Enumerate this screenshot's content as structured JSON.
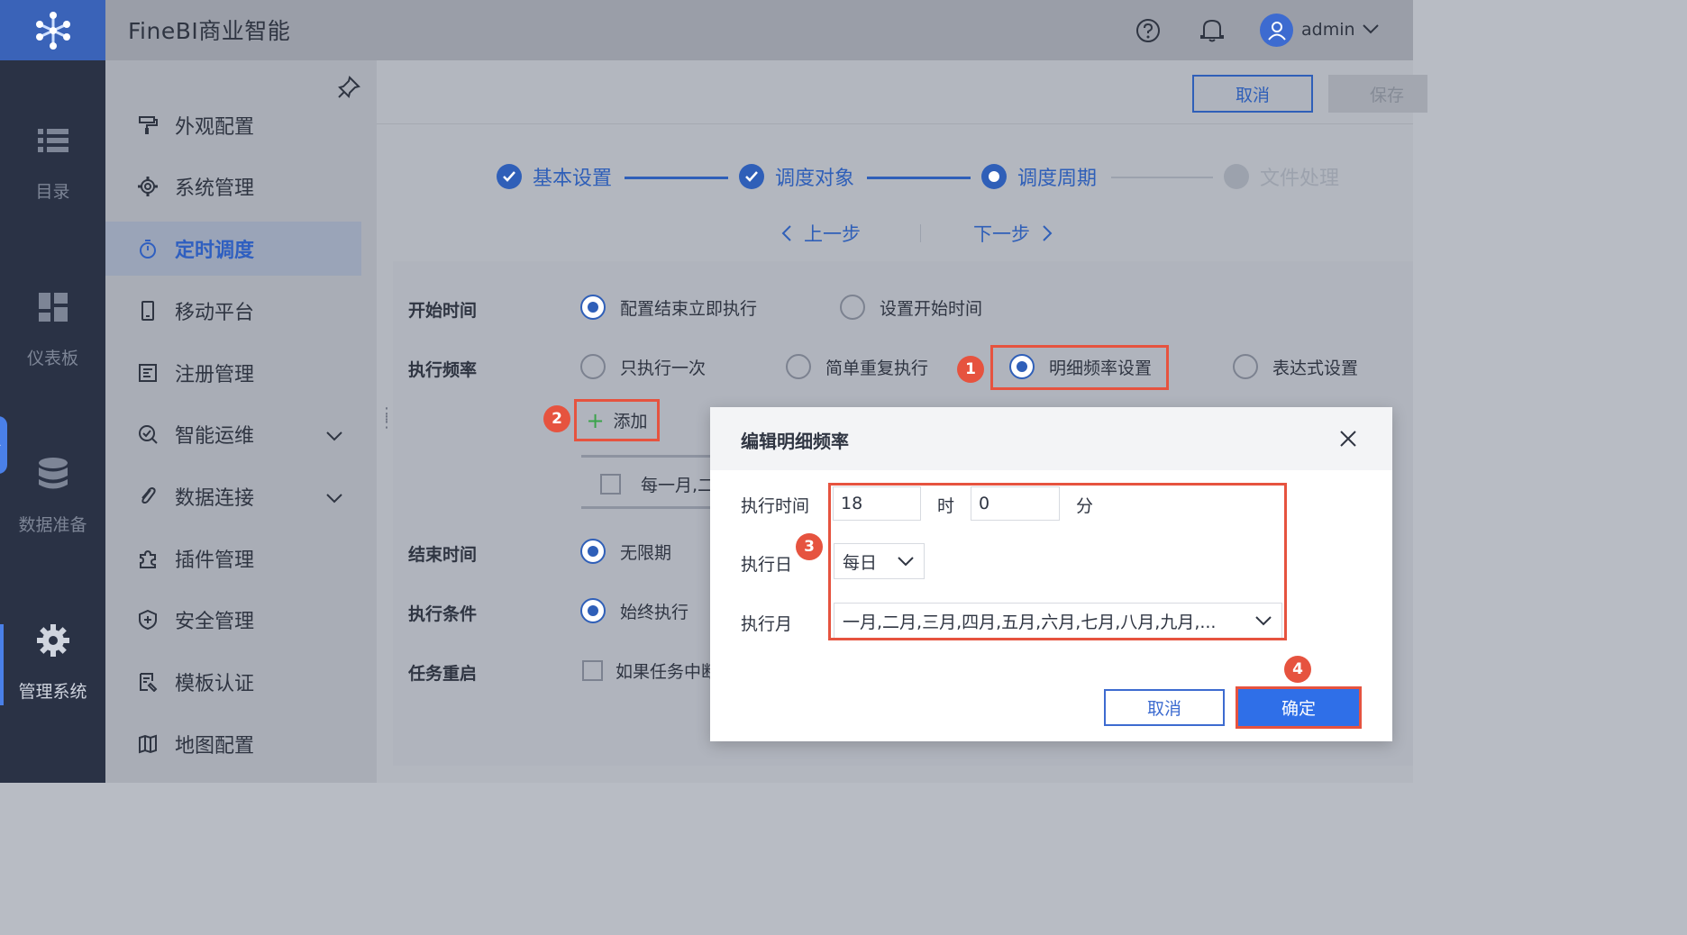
{
  "app": {
    "title": "FineBI商业智能",
    "username": "admin"
  },
  "rail": {
    "items": [
      {
        "label": "目录",
        "icon": "list-icon"
      },
      {
        "label": "仪表板",
        "icon": "dashboard-icon"
      },
      {
        "label": "数据准备",
        "icon": "database-icon"
      },
      {
        "label": "管理系统",
        "icon": "gear-icon",
        "active": true
      }
    ]
  },
  "menu": {
    "items": [
      {
        "label": "外观配置",
        "icon": "paint-roller-icon"
      },
      {
        "label": "系统管理",
        "icon": "settings-icon"
      },
      {
        "label": "定时调度",
        "icon": "timer-icon",
        "active": true
      },
      {
        "label": "移动平台",
        "icon": "mobile-icon"
      },
      {
        "label": "注册管理",
        "icon": "registration-icon"
      },
      {
        "label": "智能运维",
        "icon": "ops-icon",
        "expandable": true
      },
      {
        "label": "数据连接",
        "icon": "link-icon",
        "expandable": true
      },
      {
        "label": "插件管理",
        "icon": "plugin-icon"
      },
      {
        "label": "安全管理",
        "icon": "shield-icon"
      },
      {
        "label": "模板认证",
        "icon": "certificate-icon"
      },
      {
        "label": "地图配置",
        "icon": "map-icon"
      }
    ]
  },
  "toolbar": {
    "cancel_label": "取消",
    "save_label": "保存"
  },
  "steps": {
    "items": [
      {
        "label": "基本设置",
        "state": "done"
      },
      {
        "label": "调度对象",
        "state": "done"
      },
      {
        "label": "调度周期",
        "state": "current"
      },
      {
        "label": "文件处理",
        "state": "pending"
      }
    ],
    "prev_label": "上一步",
    "next_label": "下一步"
  },
  "form": {
    "start_time": {
      "label": "开始时间",
      "options": [
        "配置结束立即执行",
        "设置开始时间"
      ]
    },
    "frequency": {
      "label": "执行频率",
      "options": [
        "只执行一次",
        "简单重复执行",
        "明细频率设置",
        "表达式设置"
      ]
    },
    "add_label": "添加",
    "row_text": "每一月,二",
    "end_time": {
      "label": "结束时间",
      "option": "无限期"
    },
    "condition": {
      "label": "执行条件",
      "option": "始终执行"
    },
    "restart": {
      "label": "任务重启",
      "option": "如果任务中断"
    }
  },
  "badges": [
    "1",
    "2",
    "3",
    "4"
  ],
  "modal": {
    "title": "编辑明细频率",
    "exec_time_label": "执行时间",
    "hour_value": "18",
    "hour_unit": "时",
    "minute_value": "0",
    "minute_unit": "分",
    "exec_day_label": "执行日",
    "day_value": "每日",
    "exec_month_label": "执行月",
    "month_value": "一月,二月,三月,四月,五月,六月,七月,八月,九月,...",
    "cancel_label": "取消",
    "ok_label": "确定"
  },
  "colors": {
    "accent": "#2f5fb8",
    "highlight": "#e6533f",
    "primary_button": "#2f6fe8"
  }
}
